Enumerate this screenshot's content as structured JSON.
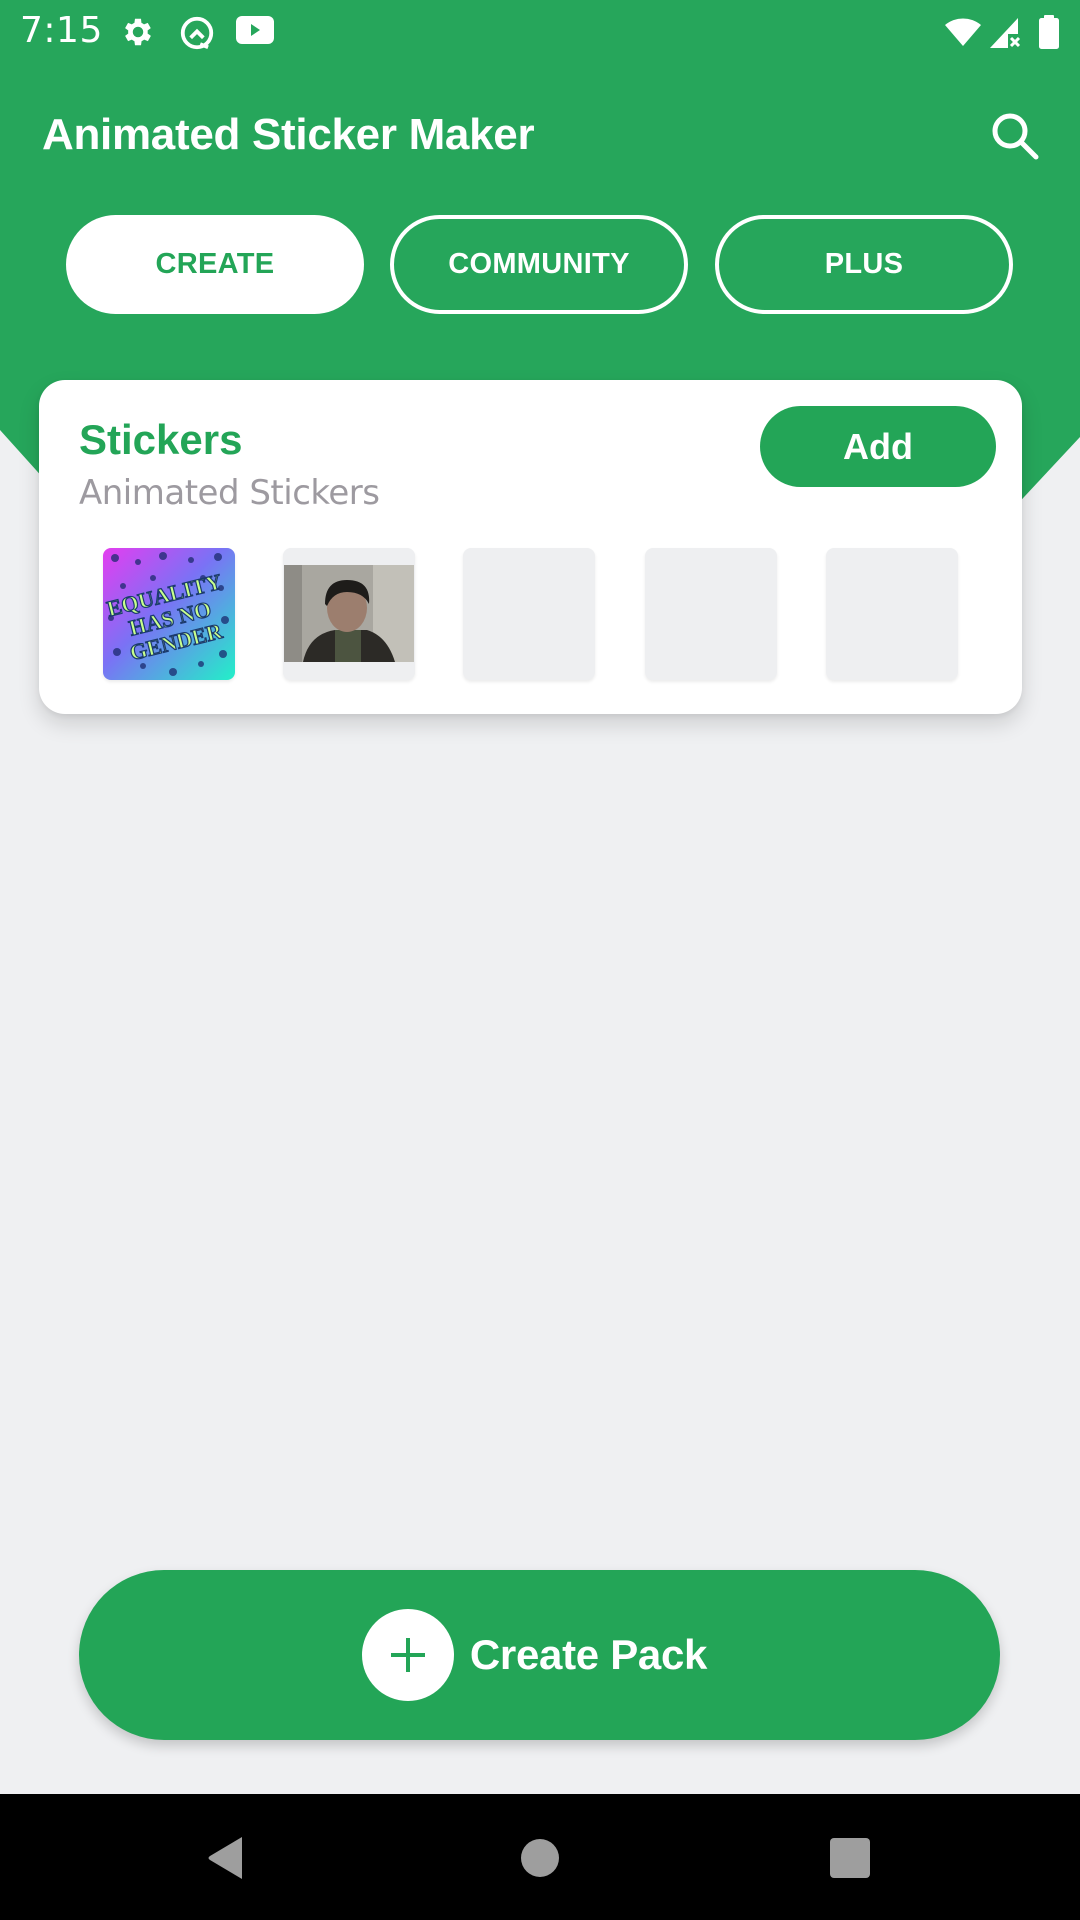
{
  "status_bar": {
    "time": "7:15",
    "left_icons": [
      "settings-gear-icon",
      "q-notification-icon",
      "youtube-icon"
    ],
    "right_icons": [
      "wifi-icon",
      "cell-signal-no-data-icon",
      "battery-icon"
    ]
  },
  "app_bar": {
    "title": "Animated Sticker Maker",
    "action_icon": "search-icon"
  },
  "tabs": [
    {
      "label": "CREATE",
      "selected": true
    },
    {
      "label": "COMMUNITY",
      "selected": false
    },
    {
      "label": "PLUS",
      "selected": false
    }
  ],
  "pack_card": {
    "title": "Stickers",
    "subtitle": "Animated Stickers",
    "add_label": "Add",
    "thumbnails": [
      {
        "type": "image",
        "description": "Equality Has No Gender sticker",
        "text_lines": [
          "EQUALITY",
          "HAS NO",
          "GENDER"
        ]
      },
      {
        "type": "image",
        "description": "Video frame of a man in a dark jacket"
      },
      {
        "type": "empty"
      },
      {
        "type": "empty"
      },
      {
        "type": "empty"
      }
    ]
  },
  "create_pack": {
    "label": "Create Pack",
    "icon": "plus-icon"
  },
  "nav_bar": {
    "buttons": [
      "back",
      "home",
      "recents"
    ]
  },
  "colors": {
    "primary_green": "#23a557",
    "background": "#eff0f2",
    "subtitle_gray": "#9d9aa0",
    "empty_thumb": "#eeeff1",
    "nav_bar": "#000000"
  }
}
